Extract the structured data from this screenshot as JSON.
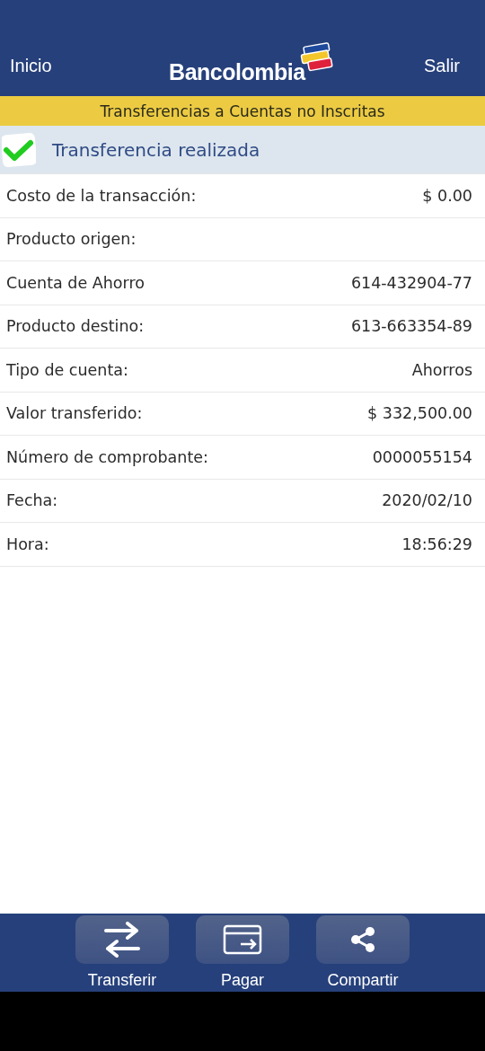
{
  "header": {
    "left_link": "Inicio",
    "logo_text": "Bancolombia",
    "right_link": "Salir"
  },
  "section_title": "Transferencias a Cuentas no Inscritas",
  "status": {
    "text": "Transferencia realizada",
    "success": true
  },
  "rows": [
    {
      "label": "Costo de la transacción:",
      "value": "$ 0.00"
    },
    {
      "label": "Producto origen:"
    },
    {
      "label": "Cuenta de Ahorro",
      "value": "614-432904-77"
    },
    {
      "label": "Producto destino:",
      "value": "613-663354-89"
    },
    {
      "label": "Tipo de cuenta:",
      "value": "Ahorros"
    },
    {
      "label": "Valor transferido:",
      "value": "$ 332,500.00"
    },
    {
      "label": "Número de comprobante:",
      "value": "0000055154"
    },
    {
      "label": "Fecha:",
      "value": "2020/02/10"
    },
    {
      "label": "Hora:",
      "value": "18:56:29"
    }
  ],
  "actions": [
    {
      "kind": "transfer",
      "label": "Transferir"
    },
    {
      "kind": "pay",
      "label": "Pagar"
    },
    {
      "kind": "share",
      "label": "Compartir"
    }
  ]
}
